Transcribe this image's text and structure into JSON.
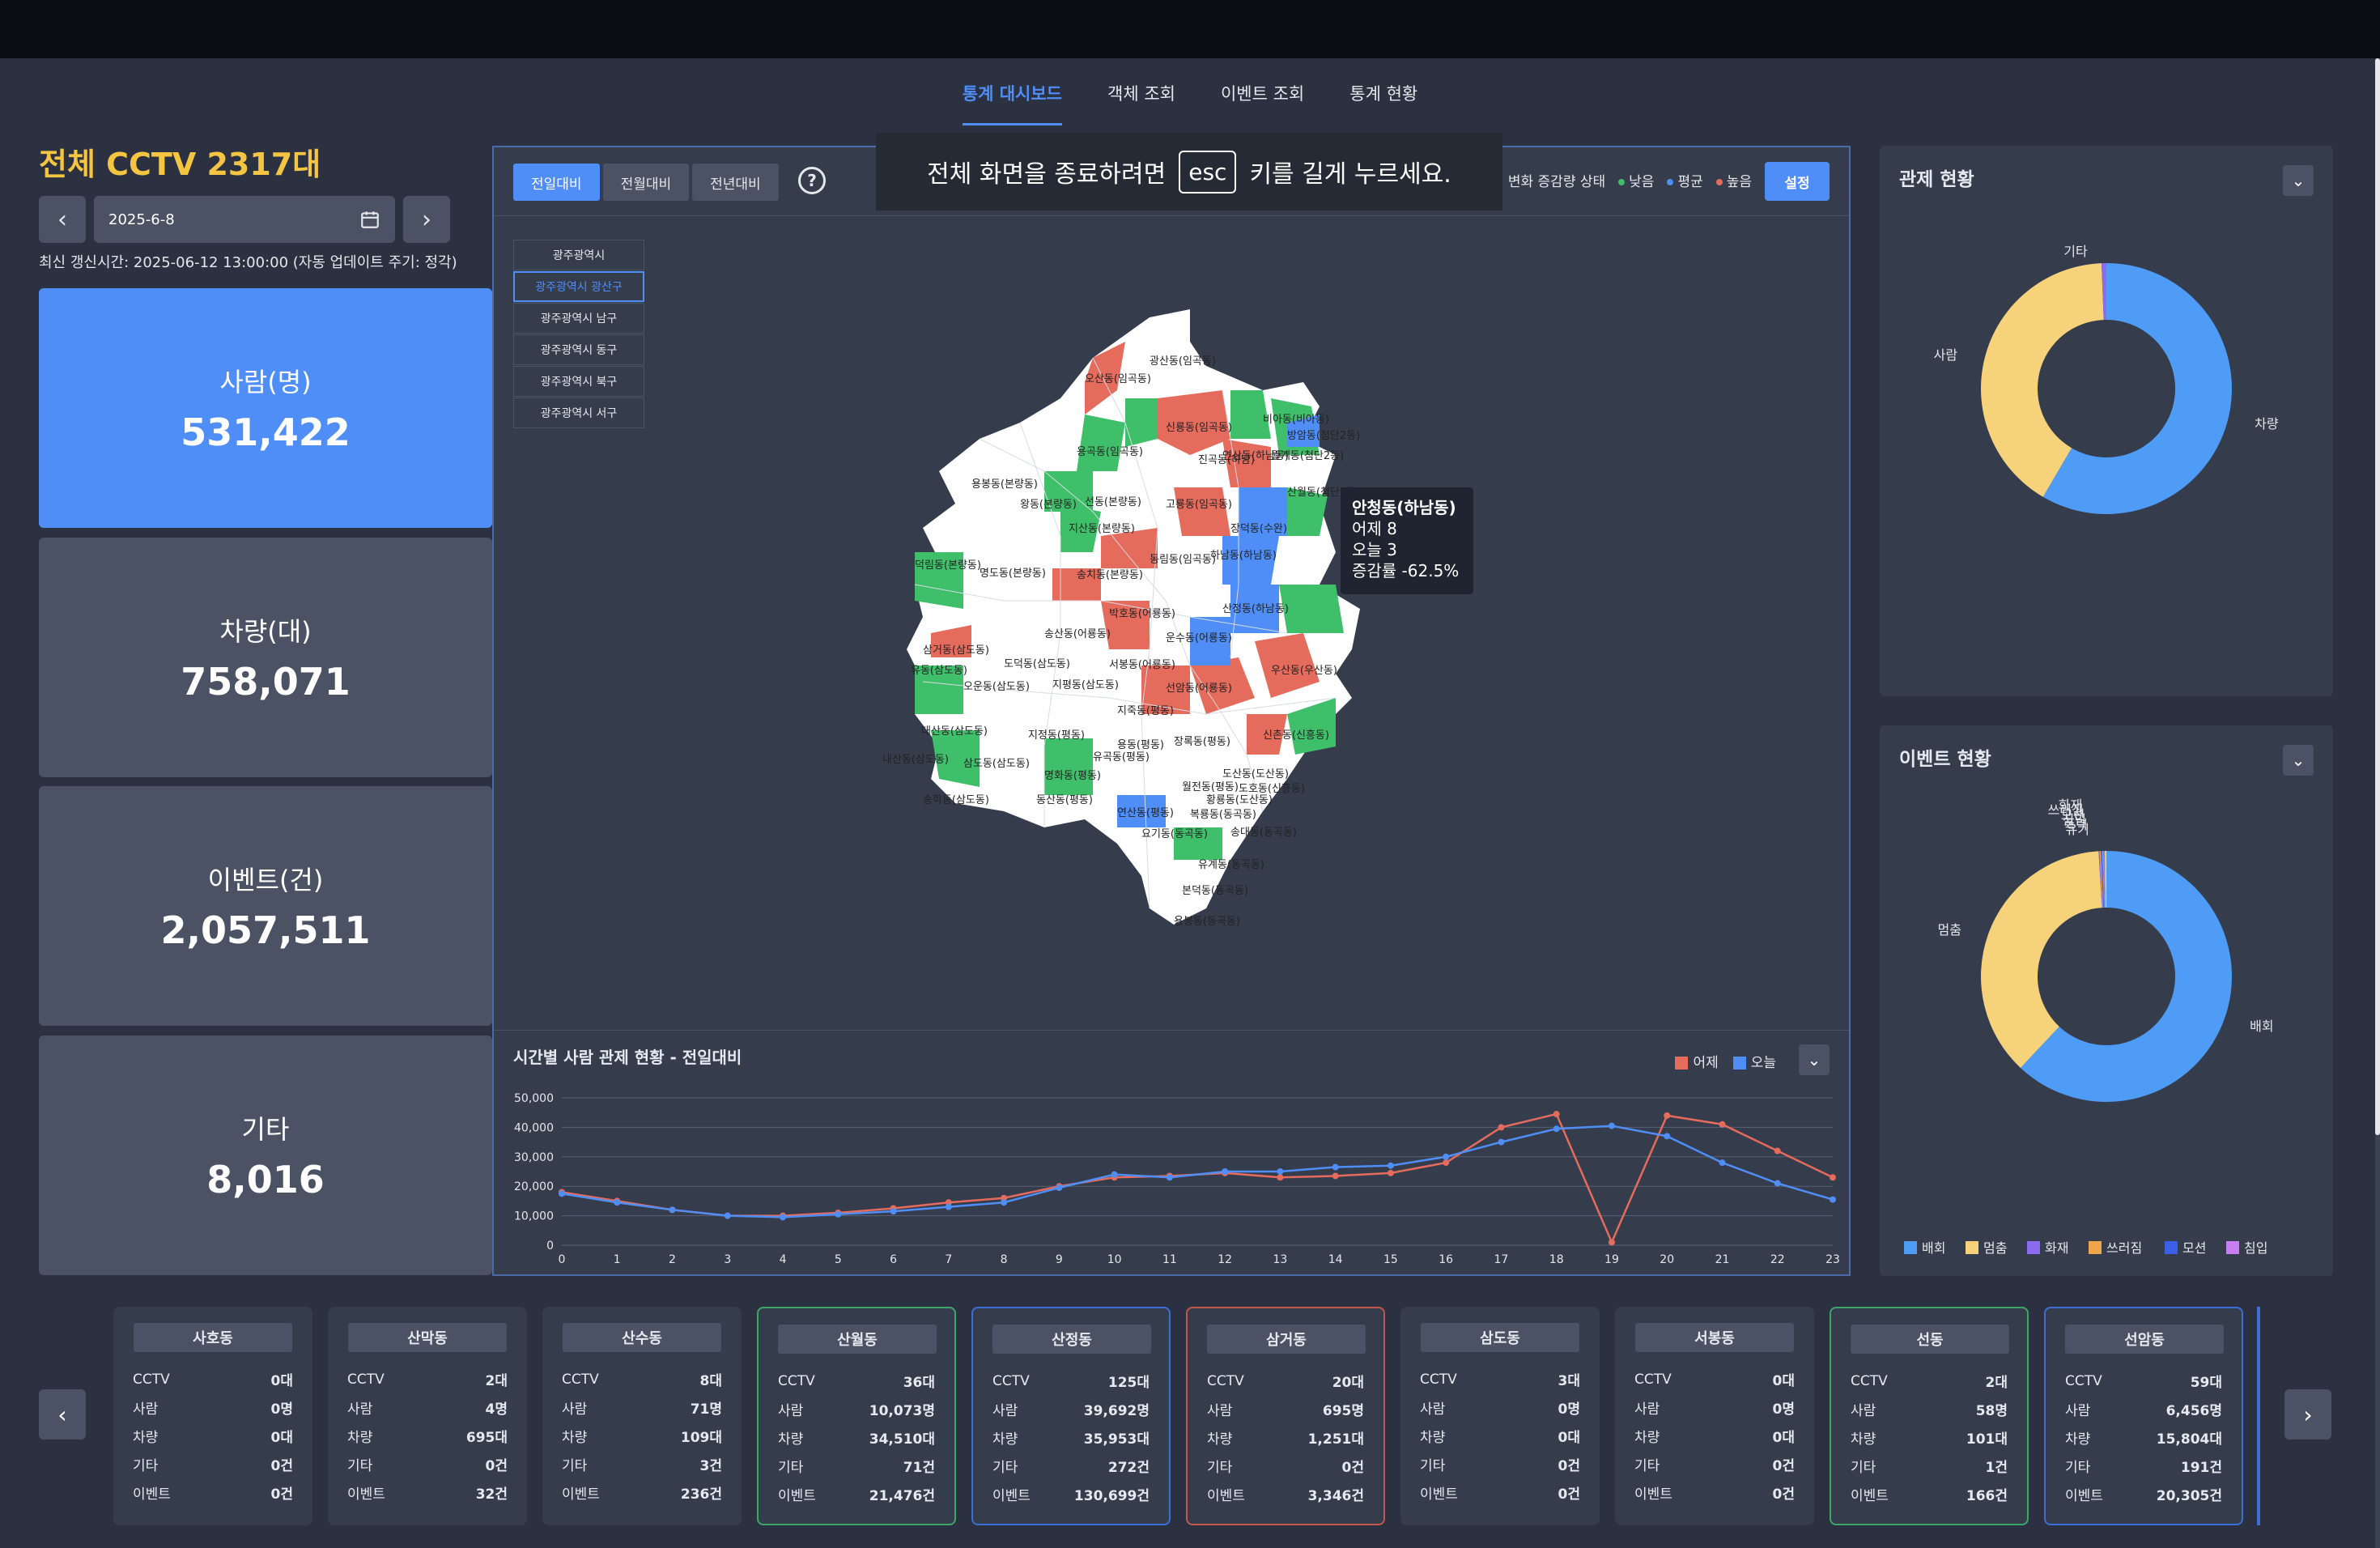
{
  "nav": {
    "tabs": [
      "통계 대시보드",
      "객체 조회",
      "이벤트 조회",
      "통계 현황"
    ],
    "active": 0
  },
  "summary": {
    "total": "전체 CCTV 2317대",
    "date": "2025-6-8",
    "updated": "최신 갱신시간: 2025-06-12 13:00:00 (자동 업데이트 주기: 정각)",
    "cards": [
      {
        "label": "사람(명)",
        "value": "531,422"
      },
      {
        "label": "차량(대)",
        "value": "758,071"
      },
      {
        "label": "이벤트(건)",
        "value": "2,057,511"
      },
      {
        "label": "기타",
        "value": "8,016"
      }
    ]
  },
  "center": {
    "tabs": [
      "전일대비",
      "전월대비",
      "전년대비"
    ],
    "legend_label": "변화 증감량 상태",
    "legend": [
      {
        "label": "낮음",
        "color": "#3fbf6a"
      },
      {
        "label": "평균",
        "color": "#4f8ef7"
      },
      {
        "label": "높음",
        "color": "#e56b5d"
      }
    ],
    "settings": "설정",
    "esc_before": "전체 화면을 종료하려면",
    "esc_key": "esc",
    "esc_after": "키를 길게 누르세요.",
    "regions": [
      "광주광역시",
      "광주광역시 광산구",
      "광주광역시 남구",
      "광주광역시 동구",
      "광주광역시 북구",
      "광주광역시 서구"
    ],
    "map_labels": [
      "광산동(임곡동)",
      "오산동(임곡동)",
      "신룡동(임곡동)",
      "비아동(비아동)",
      "방암동(첨단2동)",
      "용곡동(임곡동)",
      "진곡동(하남)",
      "연산동(하남동)",
      "월계동(첨단2동)",
      "산월동(첨단2동)",
      "용봉동(본량동)",
      "왕동(본량동)",
      "선동(본량동)",
      "고룡동(임곡동)",
      "지산동(본량동)",
      "장덕동(수완)",
      "덕림동(본량동)",
      "명도동(본량동)",
      "송치동(본량동)",
      "동림동(임곡동)",
      "하남동(하남동)",
      "박호동(어룡동)",
      "송산동(어룡동)",
      "산정동(하남동)",
      "운수동(어룡동)",
      "삼거동(삼도동)",
      "도덕동(삼도동)",
      "서봉동(어룡동)",
      "유동(삼도동)",
      "오운동(삼도동)",
      "지평동(삼도동)",
      "선암동(어룡동)",
      "우산동(우산동)",
      "지죽동(평동)",
      "대산동(삼도동)",
      "지정동(평동)",
      "용동(평동)",
      "장록동(평동)",
      "신촌동(신흥동)",
      "내산동(삼도동)",
      "삼도동(삼도동)",
      "유곡동(평동)",
      "명화동(평동)",
      "도산동(도산동)",
      "월전동(평동)",
      "도호동(신흥동)",
      "송학동(삼도동)",
      "동산동(평동)",
      "황룡동(도산동)",
      "연산동(평동)",
      "복룡동(동곡동)",
      "요기동(동곡동)",
      "송대동(동곡동)",
      "유계동(동곡동)",
      "본덕동(동곡동)",
      "용봉동(동곡동)"
    ],
    "tooltip": {
      "title": "안청동(하남동)",
      "line1": "어제 8",
      "line2": "오늘 3",
      "line3": "증감률 -62.5%"
    }
  },
  "chart_data": {
    "type": "line",
    "title": "시간별 사람 관제 현황 - 전일대비",
    "x": [
      0,
      1,
      2,
      3,
      4,
      5,
      6,
      7,
      8,
      9,
      10,
      11,
      12,
      13,
      14,
      15,
      16,
      17,
      18,
      19,
      20,
      21,
      22,
      23
    ],
    "ylim": [
      0,
      50000
    ],
    "yticks": [
      "0",
      "10,000",
      "20,000",
      "30,000",
      "40,000",
      "50,000"
    ],
    "grid": true,
    "series": [
      {
        "name": "어제",
        "color": "#e56b5d",
        "values": [
          18000,
          15000,
          12000,
          10000,
          10000,
          11000,
          12500,
          14500,
          16000,
          20000,
          23000,
          23500,
          24500,
          23000,
          23500,
          24500,
          28000,
          40000,
          44500,
          1000,
          44000,
          41000,
          32000,
          23000
        ]
      },
      {
        "name": "오늘",
        "color": "#4f8ef7",
        "values": [
          17500,
          14500,
          12000,
          10000,
          9500,
          10500,
          11500,
          13000,
          14500,
          19500,
          24000,
          23000,
          25000,
          25000,
          26500,
          27000,
          30000,
          35000,
          39500,
          40500,
          37000,
          28000,
          21000,
          15500
        ]
      }
    ]
  },
  "right": {
    "control": {
      "title": "관제 현황",
      "slices": [
        {
          "name": "차량",
          "value": 758071,
          "color": "#4f9cf7"
        },
        {
          "name": "사람",
          "value": 531422,
          "color": "#f6d37a"
        },
        {
          "name": "기타",
          "value": 8016,
          "color": "#8b6cf0"
        }
      ]
    },
    "events": {
      "title": "이벤트 현황",
      "slices": [
        {
          "name": "배회",
          "value": 62,
          "color": "#4f9cf7"
        },
        {
          "name": "멈춤",
          "value": 37,
          "color": "#f6d37a"
        },
        {
          "name": "화재",
          "value": 0.15,
          "color": "#8b6cf0"
        },
        {
          "name": "쓰러짐",
          "value": 0.15,
          "color": "#f0a54a"
        },
        {
          "name": "모션",
          "value": 0.15,
          "color": "#3b5fe6"
        },
        {
          "name": "침입",
          "value": 0.15,
          "color": "#c77ef0"
        },
        {
          "name": "폭력",
          "value": 0.2,
          "color": "#4f9cf7"
        },
        {
          "name": "유기",
          "value": 0.2,
          "color": "#f6d37a"
        }
      ]
    }
  },
  "dongs": [
    {
      "name": "사호동",
      "cctv": "0대",
      "person": "0명",
      "vehicle": "0대",
      "other": "0건",
      "event": "0건",
      "border": "none"
    },
    {
      "name": "산막동",
      "cctv": "2대",
      "person": "4명",
      "vehicle": "695대",
      "other": "0건",
      "event": "32건",
      "border": "none"
    },
    {
      "name": "산수동",
      "cctv": "8대",
      "person": "71명",
      "vehicle": "109대",
      "other": "3건",
      "event": "236건",
      "border": "none"
    },
    {
      "name": "산월동",
      "cctv": "36대",
      "person": "10,073명",
      "vehicle": "34,510대",
      "other": "71건",
      "event": "21,476건",
      "border": "green"
    },
    {
      "name": "산정동",
      "cctv": "125대",
      "person": "39,692명",
      "vehicle": "35,953대",
      "other": "272건",
      "event": "130,699건",
      "border": "blue"
    },
    {
      "name": "삼거동",
      "cctv": "20대",
      "person": "695명",
      "vehicle": "1,251대",
      "other": "0건",
      "event": "3,346건",
      "border": "red"
    },
    {
      "name": "삼도동",
      "cctv": "3대",
      "person": "0명",
      "vehicle": "0대",
      "other": "0건",
      "event": "0건",
      "border": "none"
    },
    {
      "name": "서봉동",
      "cctv": "0대",
      "person": "0명",
      "vehicle": "0대",
      "other": "0건",
      "event": "0건",
      "border": "none"
    },
    {
      "name": "선동",
      "cctv": "2대",
      "person": "58명",
      "vehicle": "101대",
      "other": "1건",
      "event": "166건",
      "border": "green"
    },
    {
      "name": "선암동",
      "cctv": "59대",
      "person": "6,456명",
      "vehicle": "15,804대",
      "other": "191건",
      "event": "20,305건",
      "border": "blue"
    }
  ],
  "dong_row_labels": [
    "CCTV",
    "사람",
    "차량",
    "기타",
    "이벤트"
  ]
}
